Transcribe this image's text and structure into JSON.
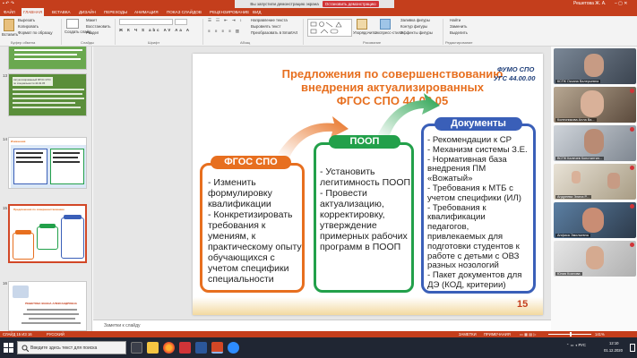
{
  "titlebar": {
    "left_hint": "Показать...",
    "share_notice": "Вы запустили демонстрацию экрана",
    "stop_share": "Остановить демонстрацию",
    "user": "Решетова Ж. А."
  },
  "tabs": [
    "ФАЙЛ",
    "ГЛАВНАЯ",
    "ВСТАВКА",
    "ДИЗАЙН",
    "ПЕРЕХОДЫ",
    "АНИМАЦИЯ",
    "ПОКАЗ СЛАЙДОВ",
    "РЕЦЕНЗИРОВАНИЕ",
    "ВИД"
  ],
  "ribbon": {
    "paste": "Вставить",
    "cut": "Вырезать",
    "copy": "Копировать",
    "format_painter": "Формат по образцу",
    "new_slide": "Создать слайд",
    "layout": "Макет",
    "reset": "Восстановить",
    "section": "Раздел",
    "text_direction": "Направление текста",
    "align_text": "Выровнять текст",
    "smartart": "Преобразовать в SmartArt",
    "arrange": "Упорядочить",
    "quick_styles": "Экспресс-стили",
    "shape_fill": "Заливка фигуры",
    "shape_outline": "Контур фигуры",
    "shape_effects": "Эффекты фигуры",
    "find": "Найти",
    "replace": "Заменить",
    "select": "Выделить",
    "groups": [
      "Буфер обмена",
      "Слайды",
      "Шрифт",
      "Абзац",
      "Рисование",
      "Редактирование"
    ]
  },
  "thumbnails": [
    {
      "num": "13",
      "title": "Актуализированный ФГОС СПО по специальности 44.02.05"
    },
    {
      "num": "14",
      "title": "Изменения"
    },
    {
      "num": "15",
      "title": "Предложения по совершенствованию"
    },
    {
      "num": "16",
      "title": "РЕШЕТОВА ЖАННА АЛЕКСАНДРОВНА"
    }
  ],
  "slide": {
    "title_lines": [
      "Предложения по совершенствованию",
      "внедрения актуализированных",
      "ФГОС СПО 44.02.05"
    ],
    "org_lines": [
      "ФУМО СПО",
      "УГС 44.00.00"
    ],
    "box1": {
      "header": "ФГОС СПО",
      "lines": [
        "- Изменить",
        "формулировку",
        "квалификации",
        "- Конкретизировать",
        "требования к",
        "умениям, к",
        "практическому опыту",
        "обучающихся с",
        "учетом специфики",
        "специальности"
      ]
    },
    "box2": {
      "header": "ПООП",
      "lines": [
        "- Установить",
        "легитимность ПООП",
        "- Провести",
        "актуализацию,",
        "корректировку,",
        "утверждение",
        "примерных рабочих",
        "программ в ПООП"
      ]
    },
    "box3": {
      "header": "Документы",
      "lines": [
        "- Рекомендации к СР",
        "- Механизм системы З.Е.",
        "- Нормативная база",
        "внедрения ПМ",
        "«Вожатый»",
        "- Требования к МТБ с",
        "учетом специфики (ИЛ)",
        "- Требования к",
        "квалификации",
        "педагогов,",
        "привлекаемых для",
        "подготовки студентов к",
        "работе с детьми с ОВЗ",
        "разных нозологий",
        "- Пакет документов для",
        "ДЭ (КОД, критерии)"
      ]
    },
    "page_number": "15"
  },
  "notes_placeholder": "Заметки к слайду",
  "participants": [
    {
      "name": "КСПК Оксана Валерьевна"
    },
    {
      "name": "Колесникова Алла Ва..."
    },
    {
      "name": "ВСПК Калечев Константин..."
    },
    {
      "name": "Андреева Элина Р..."
    },
    {
      "name": "Анфиса Эмильевна"
    },
    {
      "name": "Юлия Козлова"
    }
  ],
  "statusbar": {
    "slide_info": "СЛАЙД 15 ИЗ 16",
    "language": "РУССКИЙ",
    "notes": "ЗАМЕТКИ",
    "comments": "ПРИМЕЧАНИЯ",
    "zoom": "141%"
  },
  "taskbar": {
    "search_placeholder": "Введите здесь текст для поиска",
    "time": "12:10",
    "date": "01.12.2020"
  },
  "colors": {
    "accent": "#c43e1c",
    "orange": "#e76f1f",
    "green": "#22a04a",
    "blue": "#3a5fb8"
  }
}
